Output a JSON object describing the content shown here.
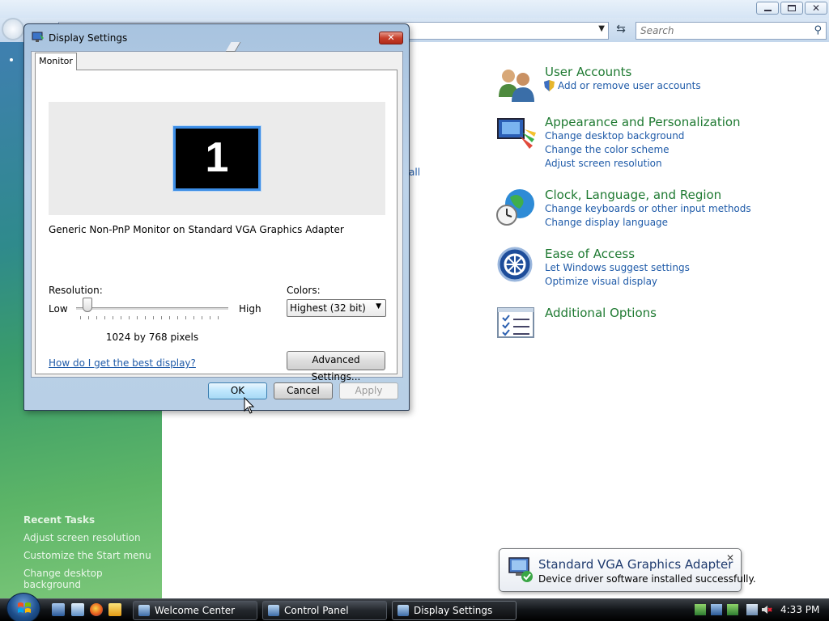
{
  "control_panel": {
    "search_placeholder": "Search",
    "partial_text": "all",
    "recent_tasks": {
      "title": "Recent Tasks",
      "items": [
        "Adjust screen resolution",
        "Customize the Start menu",
        "Change desktop background"
      ]
    },
    "categories": [
      {
        "title": "User Accounts",
        "icon": "user-accounts-icon",
        "links": [
          "Add or remove user accounts"
        ]
      },
      {
        "title": "Appearance and Personalization",
        "icon": "appearance-icon",
        "links": [
          "Change desktop background",
          "Change the color scheme",
          "Adjust screen resolution"
        ]
      },
      {
        "title": "Clock, Language, and Region",
        "icon": "clock-globe-icon",
        "links": [
          "Change keyboards or other input methods",
          "Change display language"
        ]
      },
      {
        "title": "Ease of Access",
        "icon": "ease-of-access-icon",
        "links": [
          "Let Windows suggest settings",
          "Optimize visual display"
        ]
      },
      {
        "title": "Additional Options",
        "icon": "additional-options-icon",
        "links": []
      }
    ]
  },
  "dialog": {
    "title": "Display Settings",
    "close_symbol": "✕",
    "tab": "Monitor",
    "monitor_number": "1",
    "monitor_name": "Generic Non-PnP Monitor on Standard VGA Graphics Adapter",
    "resolution_label": "Resolution:",
    "low_label": "Low",
    "high_label": "High",
    "resolution_value": "1024 by 768 pixels",
    "resolution_slider_fraction": 0.05,
    "colors_label": "Colors:",
    "colors_value": "Highest (32 bit)",
    "help_link": "How do I get the best display?",
    "advanced_button": "Advanced Settings...",
    "ok_button": "OK",
    "cancel_button": "Cancel",
    "apply_button": "Apply"
  },
  "notification": {
    "title": "Standard VGA Graphics Adapter",
    "message": "Device driver software installed successfully.",
    "close_symbol": "✕"
  },
  "taskbar": {
    "tasks": [
      "Welcome Center",
      "Control Panel",
      "Display Settings"
    ],
    "clock": "4:33 PM"
  },
  "colors": {
    "category_title": "#1f7a32",
    "link": "#1e5aa8",
    "sidebar_green": "#5db567",
    "dialog_close": "#c7402c"
  }
}
